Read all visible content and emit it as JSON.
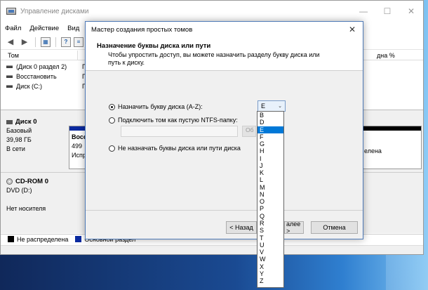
{
  "window": {
    "title": "Управление дисками",
    "minimize": "—",
    "maximize": "☐",
    "close": "✕"
  },
  "menu": [
    "Файл",
    "Действие",
    "Вид"
  ],
  "toolbar_icons": [
    "back-arrow-icon",
    "forward-arrow-icon",
    "properties-icon",
    "help-icon",
    "list-icon"
  ],
  "volume_list": {
    "header_left": "Том",
    "header_right": "дна %",
    "rows": [
      {
        "name": "(Диск 0 раздел 2)",
        "tail": "П"
      },
      {
        "name": "Восстановить",
        "tail": "П"
      },
      {
        "name": "Диск (C:)",
        "tail": "П"
      }
    ]
  },
  "disks": [
    {
      "name": "Диск 0",
      "lines": [
        "Базовый",
        "39,98 ГБ",
        "В сети"
      ],
      "part_name": "Восс",
      "part_size": "499",
      "part_status": "Испр",
      "right_status": "елена"
    },
    {
      "name": "CD-ROM 0",
      "lines": [
        "DVD (D:)",
        "",
        "Нет носителя"
      ]
    }
  ],
  "legend": [
    {
      "label": "Не распределена",
      "color": "#000000"
    },
    {
      "label": "Основной раздел",
      "color": "#0b2aa0"
    }
  ],
  "dialog": {
    "title": "Мастер создания простых томов",
    "close": "✕",
    "heading": "Назначение буквы диска или пути",
    "description": "Чтобы упростить доступ, вы можете назначить разделу букву диска или путь к диску.",
    "options": [
      {
        "label": "Назначить букву диска (A-Z):",
        "selected": true
      },
      {
        "label": "Подключить том как пустую NTFS-папку:",
        "selected": false
      },
      {
        "label": "Не назначать буквы диска или пути диска",
        "selected": false
      }
    ],
    "drive_letter_value": "E",
    "browse_label": "Об",
    "back_button": "< Назад",
    "next_button": "алее >",
    "cancel_button": "Отмена"
  },
  "dropdown": {
    "letters": [
      "B",
      "D",
      "E",
      "F",
      "G",
      "H",
      "I",
      "J",
      "K",
      "L",
      "M",
      "N",
      "O",
      "P",
      "Q",
      "R",
      "S",
      "T",
      "U",
      "V",
      "W",
      "X",
      "Y",
      "Z"
    ],
    "highlighted": "E"
  },
  "colors": {
    "accent": "#0078d7",
    "partition_bar": "#0b2aa0"
  }
}
